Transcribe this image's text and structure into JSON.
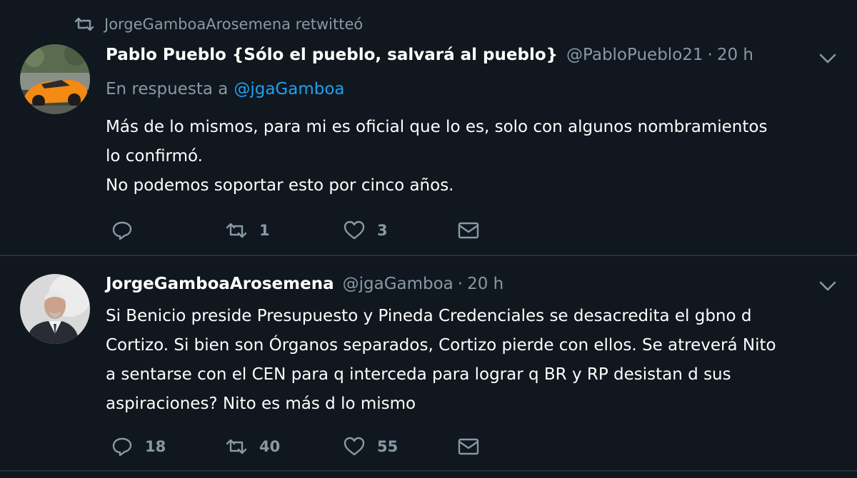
{
  "colors": {
    "background": "#10171e",
    "divider": "#26323f",
    "secondary_text": "#8899a6",
    "link": "#1da1f2",
    "primary_text": "#ffffff"
  },
  "retweet_context": {
    "icon": "retweet-icon",
    "text": "JorgeGamboaArosemena retwitteó"
  },
  "tweets": [
    {
      "display_name": "Pablo Pueblo {Sólo el pueblo, salvará al pueblo}",
      "handle": "@PabloPueblo21",
      "separator": "·",
      "time": "20 h",
      "reply_to_label": "En respuesta a",
      "reply_to_mention": "@jgaGamboa",
      "lines": [
        "Más de lo mismos, para mi es oficial que lo es, solo con algunos nombramientos",
        "lo confirmó.",
        "No podemos soportar esto por cinco años."
      ],
      "actions": {
        "reply_count": "",
        "retweet_count": "1",
        "like_count": "3"
      }
    },
    {
      "display_name": "JorgeGamboaArosemena",
      "handle": "@jgaGamboa",
      "separator": "·",
      "time": "20 h",
      "lines": [
        "Si Benicio preside Presupuesto y Pineda Credenciales se desacredita el gbno d",
        "Cortizo. Si bien son Órganos separados, Cortizo pierde con ellos. Se atreverá Nito",
        "a sentarse con el CEN para q interceda para lograr q BR y RP desistan d sus",
        "aspiraciones? Nito es más d lo mismo"
      ],
      "actions": {
        "reply_count": "18",
        "retweet_count": "40",
        "like_count": "55"
      }
    }
  ]
}
